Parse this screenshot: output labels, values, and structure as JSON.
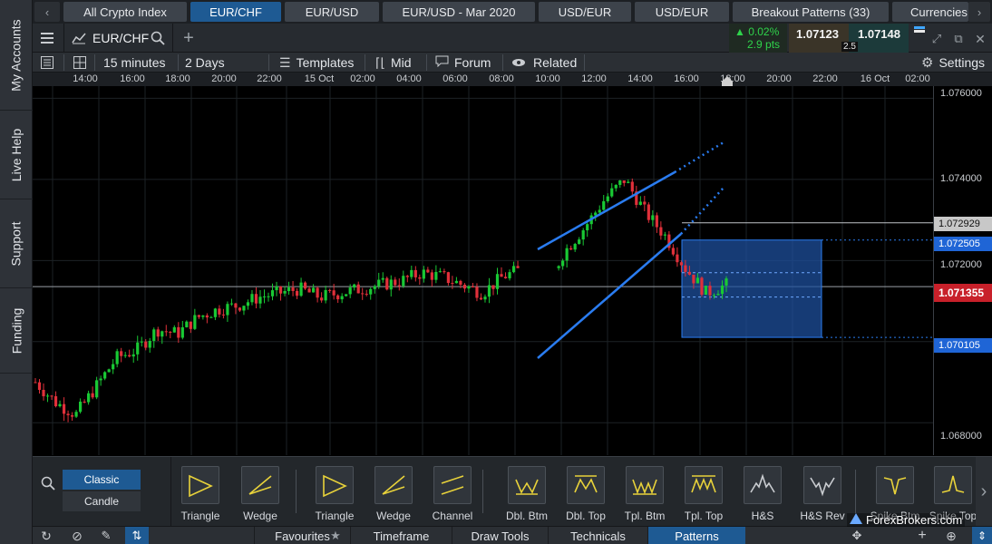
{
  "rail": {
    "items": [
      "My Accounts",
      "Live Help",
      "Support",
      "Funding"
    ]
  },
  "tabs": [
    "All Crypto Index",
    "EUR/CHF",
    "EUR/USD",
    "EUR/USD - Mar 2020",
    "USD/EUR",
    "USD/EUR",
    "Breakout Patterns (33)",
    "Currencies"
  ],
  "header": {
    "instrument": "EUR/CHF",
    "change_pct": "0.02%",
    "change_pts": "2.9 pts",
    "sell_price": "1.07123",
    "buy_price": "1.07148",
    "spread": "2.5"
  },
  "toolbar": {
    "interval": "15 minutes",
    "range": "2 Days",
    "templates": "Templates",
    "price_type": "Mid",
    "forum": "Forum",
    "related": "Related",
    "settings": "Settings"
  },
  "time_axis": [
    "14:00",
    "16:00",
    "18:00",
    "20:00",
    "22:00",
    "15 Oct",
    "02:00",
    "04:00",
    "06:00",
    "08:00",
    "10:00",
    "12:00",
    "14:00",
    "16:00",
    "18:00",
    "20:00",
    "22:00",
    "16 Oct",
    "02:00"
  ],
  "price_axis": {
    "ticks": [
      "1.076000",
      "1.074000",
      "1.072000",
      "1.070000",
      "1.068000"
    ],
    "tick_values": [
      1.076,
      1.074,
      1.072,
      1.07,
      1.068
    ],
    "line_upper": "1.072929",
    "line_target": "1.072505",
    "current": "1.071355",
    "line_lower": "1.070105"
  },
  "colors": {
    "up": "#19c934",
    "down": "#e0303a",
    "trendline": "#2a7cf0",
    "current_price": "#c8202a",
    "target_box": "#1d4f9c"
  },
  "chart_data": {
    "type": "candlestick",
    "instrument": "EUR/CHF",
    "interval": "15 minutes",
    "ylim": [
      1.0672,
      1.0763
    ],
    "closes_approx": [
      1.069,
      1.0685,
      1.0682,
      1.0689,
      1.0696,
      1.0698,
      1.0703,
      1.0702,
      1.0706,
      1.0708,
      1.0709,
      1.0711,
      1.0712,
      1.0713,
      1.0711,
      1.0712,
      1.0713,
      1.0714,
      1.0715,
      1.0717,
      1.0716,
      1.0714,
      1.0712,
      1.0716,
      1.0718,
      1.0712,
      1.0722,
      1.0728,
      1.0735,
      1.074,
      1.0732,
      1.0726,
      1.0718,
      1.0712,
      1.0714
    ]
  },
  "patterns": {
    "chart_types": [
      "Classic",
      "Candle"
    ],
    "items": [
      {
        "label": "Triangle",
        "icon": "triangle-pattern-icon",
        "color": "#e8d23a"
      },
      {
        "label": "Wedge",
        "icon": "wedge-pattern-icon",
        "color": "#e8d23a"
      },
      {
        "label": "Triangle",
        "icon": "triangle-pattern-icon",
        "color": "#e8d23a"
      },
      {
        "label": "Wedge",
        "icon": "wedge-pattern-icon",
        "color": "#e8d23a"
      },
      {
        "label": "Channel",
        "icon": "channel-pattern-icon",
        "color": "#e8d23a"
      },
      {
        "label": "Dbl. Btm",
        "icon": "double-bottom-icon",
        "color": "#e8d23a"
      },
      {
        "label": "Dbl. Top",
        "icon": "double-top-icon",
        "color": "#e8d23a"
      },
      {
        "label": "Tpl. Btm",
        "icon": "triple-bottom-icon",
        "color": "#e8d23a"
      },
      {
        "label": "Tpl. Top",
        "icon": "triple-top-icon",
        "color": "#e8d23a"
      },
      {
        "label": "H&S",
        "icon": "head-shoulders-icon",
        "color": "#c9ccd0"
      },
      {
        "label": "H&S Rev",
        "icon": "head-shoulders-rev-icon",
        "color": "#c9ccd0"
      },
      {
        "label": "Spike Btm",
        "icon": "spike-bottom-icon",
        "color": "#e8d23a"
      },
      {
        "label": "Spike Top",
        "icon": "spike-top-icon",
        "color": "#e8d23a"
      }
    ]
  },
  "bottom_tabs": [
    "Favourites",
    "Timeframe",
    "Draw Tools",
    "Technicals",
    "Patterns"
  ],
  "watermark": "ForexBrokers.com"
}
